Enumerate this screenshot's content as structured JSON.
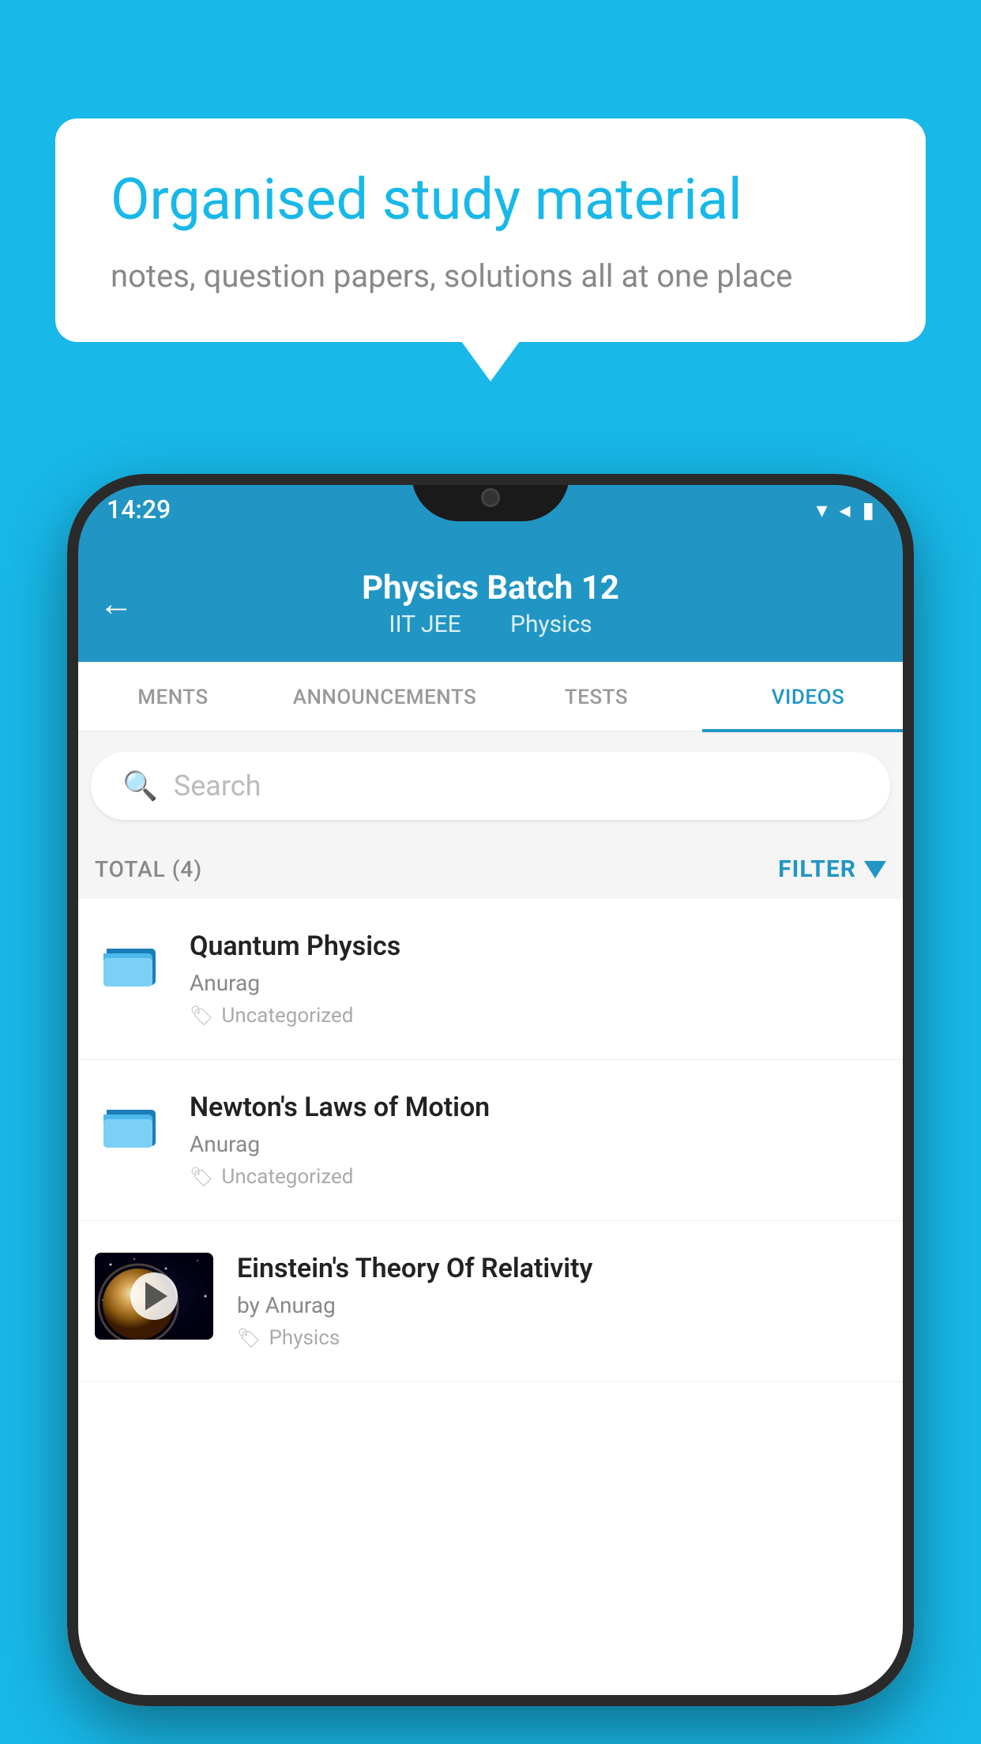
{
  "background_color": "#18b8e8",
  "speech_bubble": {
    "title": "Organised study material",
    "subtitle": "notes, question papers, solutions all at one place"
  },
  "phone": {
    "status_bar": {
      "time": "14:29"
    },
    "header": {
      "back_label": "←",
      "title": "Physics Batch 12",
      "subtitle_part1": "IIT JEE",
      "subtitle_part2": "Physics"
    },
    "tabs": [
      {
        "label": "MENTS",
        "active": false
      },
      {
        "label": "ANNOUNCEMENTS",
        "active": false
      },
      {
        "label": "TESTS",
        "active": false
      },
      {
        "label": "VIDEOS",
        "active": true
      }
    ],
    "search": {
      "placeholder": "Search"
    },
    "filter_bar": {
      "total_label": "TOTAL (4)",
      "filter_label": "FILTER"
    },
    "video_items": [
      {
        "title": "Quantum Physics",
        "author": "Anurag",
        "tag": "Uncategorized",
        "has_thumbnail": false
      },
      {
        "title": "Newton's Laws of Motion",
        "author": "Anurag",
        "tag": "Uncategorized",
        "has_thumbnail": false
      },
      {
        "title": "Einstein's Theory Of Relativity",
        "author": "by Anurag",
        "tag": "Physics",
        "has_thumbnail": true
      }
    ]
  }
}
